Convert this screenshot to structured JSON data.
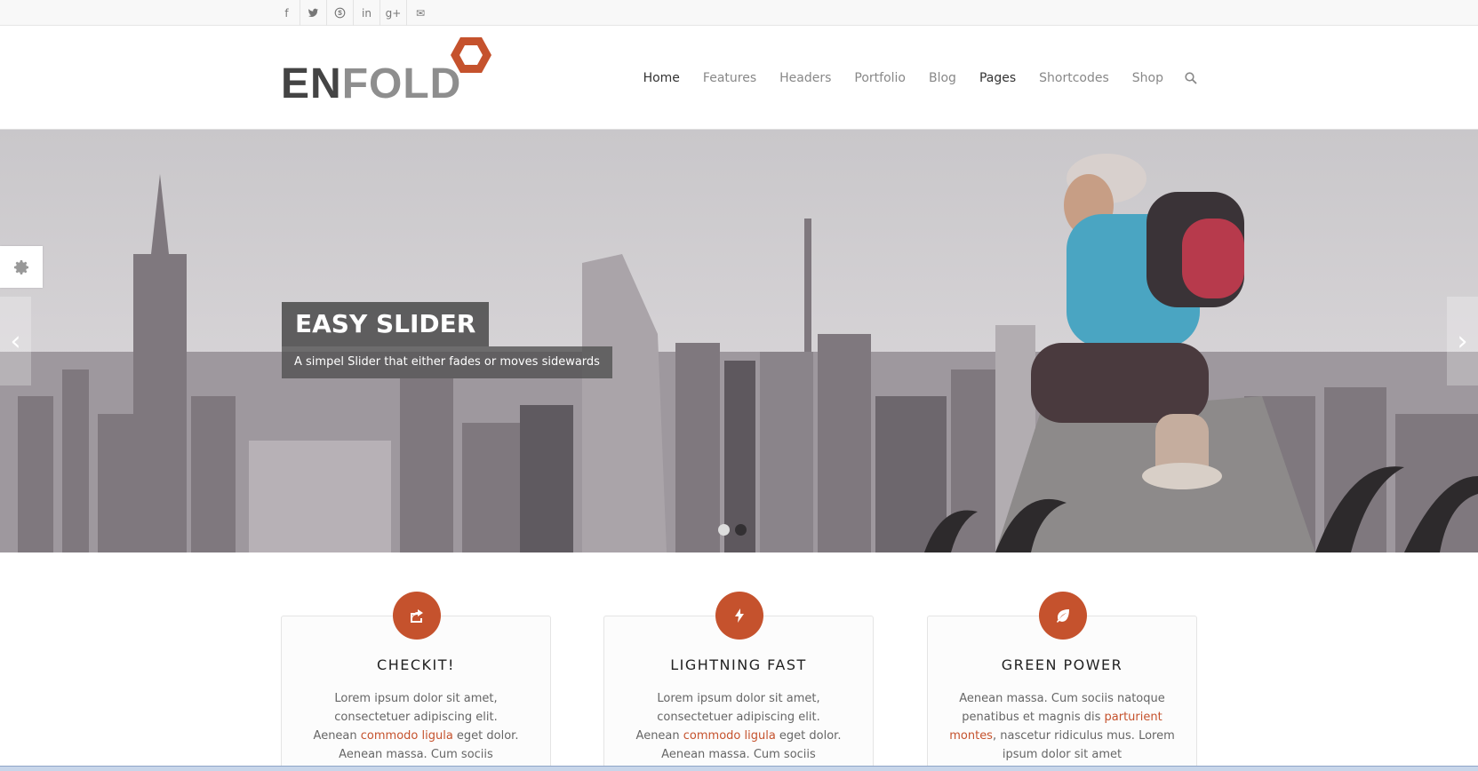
{
  "social": [
    {
      "icon": "facebook-icon",
      "glyph": "f"
    },
    {
      "icon": "twitter-icon",
      "glyph": "t"
    },
    {
      "icon": "skype-icon",
      "glyph": "S"
    },
    {
      "icon": "linkedin-icon",
      "glyph": "in"
    },
    {
      "icon": "googleplus-icon",
      "glyph": "g+"
    },
    {
      "icon": "mail-icon",
      "glyph": "✉"
    }
  ],
  "logo": {
    "part1": "EN",
    "part2": "FOLD",
    "accent": "#c5522d"
  },
  "nav": {
    "items": [
      "Home",
      "Features",
      "Headers",
      "Portfolio",
      "Blog",
      "Pages",
      "Shortcodes",
      "Shop"
    ],
    "active": "Home"
  },
  "slider": {
    "title": "EASY SLIDER",
    "subtitle": "A simpel Slider that either fades or moves sidewards",
    "prev_glyph": "‹",
    "next_glyph": "›",
    "active_slide": 1,
    "slide_count": 2
  },
  "features": [
    {
      "icon": "share-icon",
      "title": "CHECKIT!",
      "line1": "Lorem ipsum dolor sit amet, consectetuer adipiscing elit.",
      "pre": "Aenean ",
      "highlight": "commodo ligula",
      "post": " eget dolor. Aenean massa. Cum sociis"
    },
    {
      "icon": "lightning-icon",
      "title": "LIGHTNING FAST",
      "line1": "Lorem ipsum dolor sit amet, consectetuer adipiscing elit.",
      "pre": "Aenean ",
      "highlight": "commodo ligula",
      "post": " eget dolor. Aenean massa. Cum sociis"
    },
    {
      "icon": "leaf-icon",
      "title": "GREEN POWER",
      "line1": "",
      "pre": "Aenean massa. Cum sociis natoque penatibus et magnis dis ",
      "highlight": "parturient montes",
      "post": ", nascetur ridiculus mus. Lorem ipsum dolor sit amet"
    }
  ],
  "colors": {
    "accent": "#c5522d",
    "text": "#666666",
    "heading": "#222222"
  }
}
